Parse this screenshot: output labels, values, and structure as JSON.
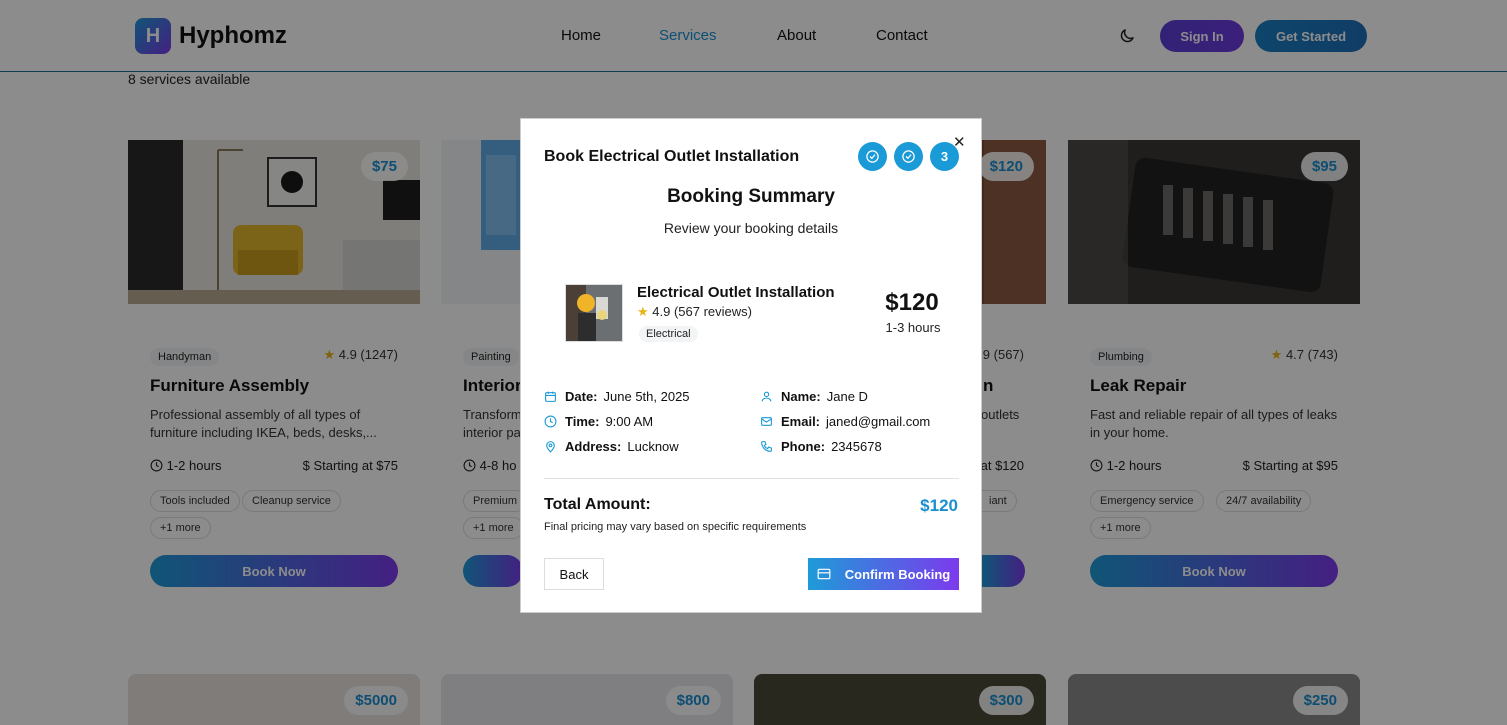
{
  "header": {
    "logo_letter": "H",
    "brand": "Hyphomz",
    "nav": [
      "Home",
      "Services",
      "About",
      "Contact"
    ],
    "active_nav": "Services",
    "signin_label": "Sign In",
    "get_started_label": "Get Started"
  },
  "page": {
    "available_text": "8 services available"
  },
  "cards": [
    {
      "price": "$75",
      "category": "Handyman",
      "rating": "4.9 (1247)",
      "title": "Furniture Assembly",
      "desc": "Professional assembly of all types of furniture including IKEA, beds, desks,...",
      "duration": "1-2 hours",
      "starting": "Starting at $75",
      "tags": [
        "Tools included",
        "Cleanup service"
      ],
      "more": "+1 more",
      "book_label": "Book Now"
    },
    {
      "price": "",
      "category": "Painting",
      "rating": "",
      "title": "Interior",
      "desc": "Transform interior pa",
      "duration": "4-8 ho",
      "starting": "",
      "tags": [
        "Premium"
      ],
      "more": "+1 more",
      "book_label": ""
    },
    {
      "price": "$120",
      "category": "",
      "rating": "9 (567)",
      "title": "n",
      "desc": "outlets",
      "duration": "",
      "starting": "at $120",
      "tags": [
        "iant"
      ],
      "more": "",
      "book_label": ""
    },
    {
      "price": "$95",
      "category": "Plumbing",
      "rating": "4.7 (743)",
      "title": "Leak Repair",
      "desc": "Fast and reliable repair of all types of leaks in your home.",
      "duration": "1-2 hours",
      "starting": "Starting at $95",
      "tags": [
        "Emergency service",
        "24/7 availability"
      ],
      "more": "+1 more",
      "book_label": "Book Now"
    }
  ],
  "row2_prices": [
    "$5000",
    "$800",
    "$300",
    "$250"
  ],
  "modal": {
    "title": "Book Electrical Outlet Installation",
    "step_current": "3",
    "heading": "Booking Summary",
    "subheading": "Review your booking details",
    "service": {
      "name": "Electrical Outlet Installation",
      "rating": "4.9 (567 reviews)",
      "category": "Electrical",
      "price": "$120",
      "duration": "1-3 hours"
    },
    "details": {
      "date_label": "Date:",
      "date": "June 5th, 2025",
      "time_label": "Time:",
      "time": "9:00 AM",
      "address_label": "Address:",
      "address": "Lucknow",
      "name_label": "Name:",
      "name": "Jane D",
      "email_label": "Email:",
      "email": "janed@gmail.com",
      "phone_label": "Phone:",
      "phone": "2345678"
    },
    "total_label": "Total Amount:",
    "total": "$120",
    "note": "Final pricing may vary based on specific requirements",
    "back_label": "Back",
    "confirm_label": "Confirm Booking"
  },
  "colors": {
    "accent": "#1a8fd0",
    "gradient_start": "#1e9bd8",
    "gradient_end": "#7c3aed"
  }
}
